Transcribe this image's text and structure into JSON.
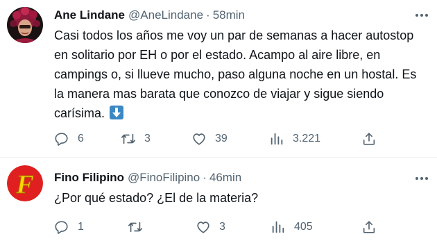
{
  "tweets": [
    {
      "name": "Ane Lindane",
      "handle": "@AneLindane",
      "separator": "·",
      "time": "58min",
      "text": "Casi todos los años me voy un par de semanas a hacer autostop en solitario por EH o por el estado. Acampo al aire libre, en campings o, si llueve mucho, paso alguna noche en un hostal. Es la manera mas barata que conozco de viajar y sigue siendo carísima.",
      "emoji": "down-arrow-button",
      "replies": "6",
      "retweets": "3",
      "likes": "39",
      "views": "3.221"
    },
    {
      "name": "Fino Filipino",
      "handle": "@FinoFilipino",
      "separator": "·",
      "time": "46min",
      "text": "¿Por qué estado? ¿El de la materia?",
      "avatar_letter": "F",
      "replies": "1",
      "retweets": "",
      "likes": "3",
      "views": "405"
    }
  ],
  "colors": {
    "text": "#0f1419",
    "secondary": "#536471",
    "divider": "#eff3f4",
    "emoji_blue": "#3b88c3",
    "avatar2_red": "#e02020",
    "avatar2_yellow": "#ffd600"
  },
  "icons": [
    "reply-icon",
    "retweet-icon",
    "like-icon",
    "views-icon",
    "share-icon",
    "more-icon"
  ]
}
